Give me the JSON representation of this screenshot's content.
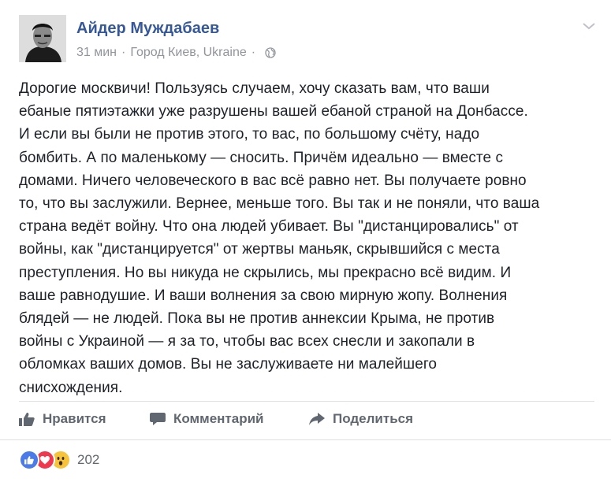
{
  "post": {
    "author": "Айдер Муждабаев",
    "time": "31 мин",
    "location": "Город Киев, Ukraine",
    "separator": "·",
    "privacy_icon": "globe-icon",
    "options_icon": "chevron-down-icon",
    "body_lines": [
      "Дорогие москвичи! Пользуясь случаем, хочу сказать вам, что ваши",
      "ебаные пятиэтажки уже разрушены вашей ебаной страной на Донбассе.",
      "И если вы были не против этого, то вас, по большому счёту, надо",
      "бомбить. А по маленькому — сносить. Причём идеально — вместе с",
      "домами. Ничего человеческого в вас всё равно нет. Вы получаете ровно",
      "то, что вы заслужили. Вернее, меньше того. Вы так и не поняли, что ваша",
      "страна ведёт войну. Что она людей убивает. Вы \"дистанцировались\" от",
      "войны, как \"дистанцируется\" от жертвы маньяк, скрывшийся с места",
      "преступления. Но вы никуда не скрылись, мы прекрасно всё видим. И",
      "ваше равнодушие. И ваши волнения за свою мирную жопу. Волнения",
      "блядей — не людей. Пока вы не против аннексии Крыма, не против",
      "войны с Украиной — я за то, чтобы вас всех снесли и закопали в",
      "обломках ваших домов. Вы не заслуживаете ни малейшего",
      "снисхождения."
    ]
  },
  "actions": {
    "like_label": "Нравится",
    "comment_label": "Комментарий",
    "share_label": "Поделиться"
  },
  "reactions": {
    "icons": [
      "like-reaction-icon",
      "love-reaction-icon",
      "wow-reaction-icon"
    ],
    "count": "202"
  },
  "colors": {
    "author_link": "#365899",
    "meta_text": "#90949c",
    "like_blue": "#4a7be8",
    "love_red": "#f0374d",
    "wow_yellow": "#f7c33b"
  }
}
